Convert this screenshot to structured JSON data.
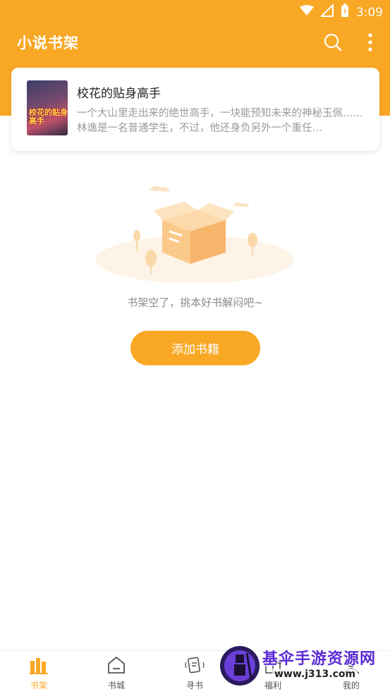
{
  "status_bar": {
    "time": "3:09"
  },
  "app": {
    "title": "小说书架"
  },
  "book": {
    "title": "校花的贴身高手",
    "description": "一个大山里走出来的绝世高手，一块能预知未来的神秘玉佩……林逸是一名普通学生，不过，他还身负另外一个重任…",
    "cover_text": "校花的贴身高手"
  },
  "empty_state": {
    "message": "书架空了，挑本好书解闷吧~",
    "button_label": "添加书籍"
  },
  "tabs": [
    {
      "label": "书架",
      "active": true
    },
    {
      "label": "书城",
      "active": false
    },
    {
      "label": "寻书",
      "active": false
    },
    {
      "label": "福利",
      "active": false
    },
    {
      "label": "我的",
      "active": false
    }
  ],
  "watermark": {
    "text": "基伞手游资源网",
    "url": "www.j313.com"
  },
  "colors": {
    "accent": "#f9a825",
    "text_gray": "#8c8c8c"
  }
}
